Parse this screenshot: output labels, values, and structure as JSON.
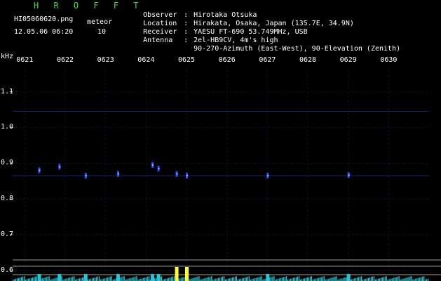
{
  "header": {
    "title": "H R O F F T",
    "filename": "HI05060620.png",
    "datetime": "12.05.06 06:20",
    "meteor_label": "meteor",
    "meteor_count": "10"
  },
  "station": [
    {
      "key": "Observer",
      "value": "Hirotaka Otsuka"
    },
    {
      "key": "Location",
      "value": "Hirakata, Osaka, Japan (135.7E, 34.9N)"
    },
    {
      "key": "Receiver",
      "value": "YAESU FT-690 53.749MHz, USB"
    },
    {
      "key": "Antenna",
      "value": "2el-HB9CV, 4m's high"
    },
    {
      "key": "",
      "value": "90-270-Azimuth (East-West), 90-Elevation (Zenith)"
    }
  ],
  "colors": {
    "title": "#3ddc3d",
    "grid": "#0a1a3a",
    "signal": "#2a52ff",
    "bright_signal": "#7fd0ff",
    "histogram": "#1fc7d8",
    "histogram_peak": "#ffff33",
    "baseline": "#9a9a9a"
  },
  "chart_data": {
    "type": "heatmap",
    "ylabel": "kHz",
    "y_ticks": [
      "1.1",
      "1.0",
      "0.9",
      "0.8",
      "0.7",
      "0.6"
    ],
    "y_range": [
      0.58,
      1.17
    ],
    "x_ticks": [
      "0621",
      "0622",
      "0623",
      "0624",
      "0625",
      "0626",
      "0627",
      "0628",
      "0629",
      "0630"
    ],
    "x_range": [
      620.7,
      631.0
    ],
    "meteor_count": 10,
    "signal_bands_khz": [
      1.045,
      0.865
    ],
    "echoes": [
      {
        "time": 621.35,
        "khz": 0.88
      },
      {
        "time": 621.85,
        "khz": 0.89
      },
      {
        "time": 622.5,
        "khz": 0.865
      },
      {
        "time": 623.3,
        "khz": 0.87
      },
      {
        "time": 624.15,
        "khz": 0.895
      },
      {
        "time": 624.3,
        "khz": 0.885
      },
      {
        "time": 624.75,
        "khz": 0.87
      },
      {
        "time": 625.0,
        "khz": 0.865
      },
      {
        "time": 627.0,
        "khz": 0.865
      },
      {
        "time": 629.0,
        "khz": 0.867
      }
    ]
  }
}
